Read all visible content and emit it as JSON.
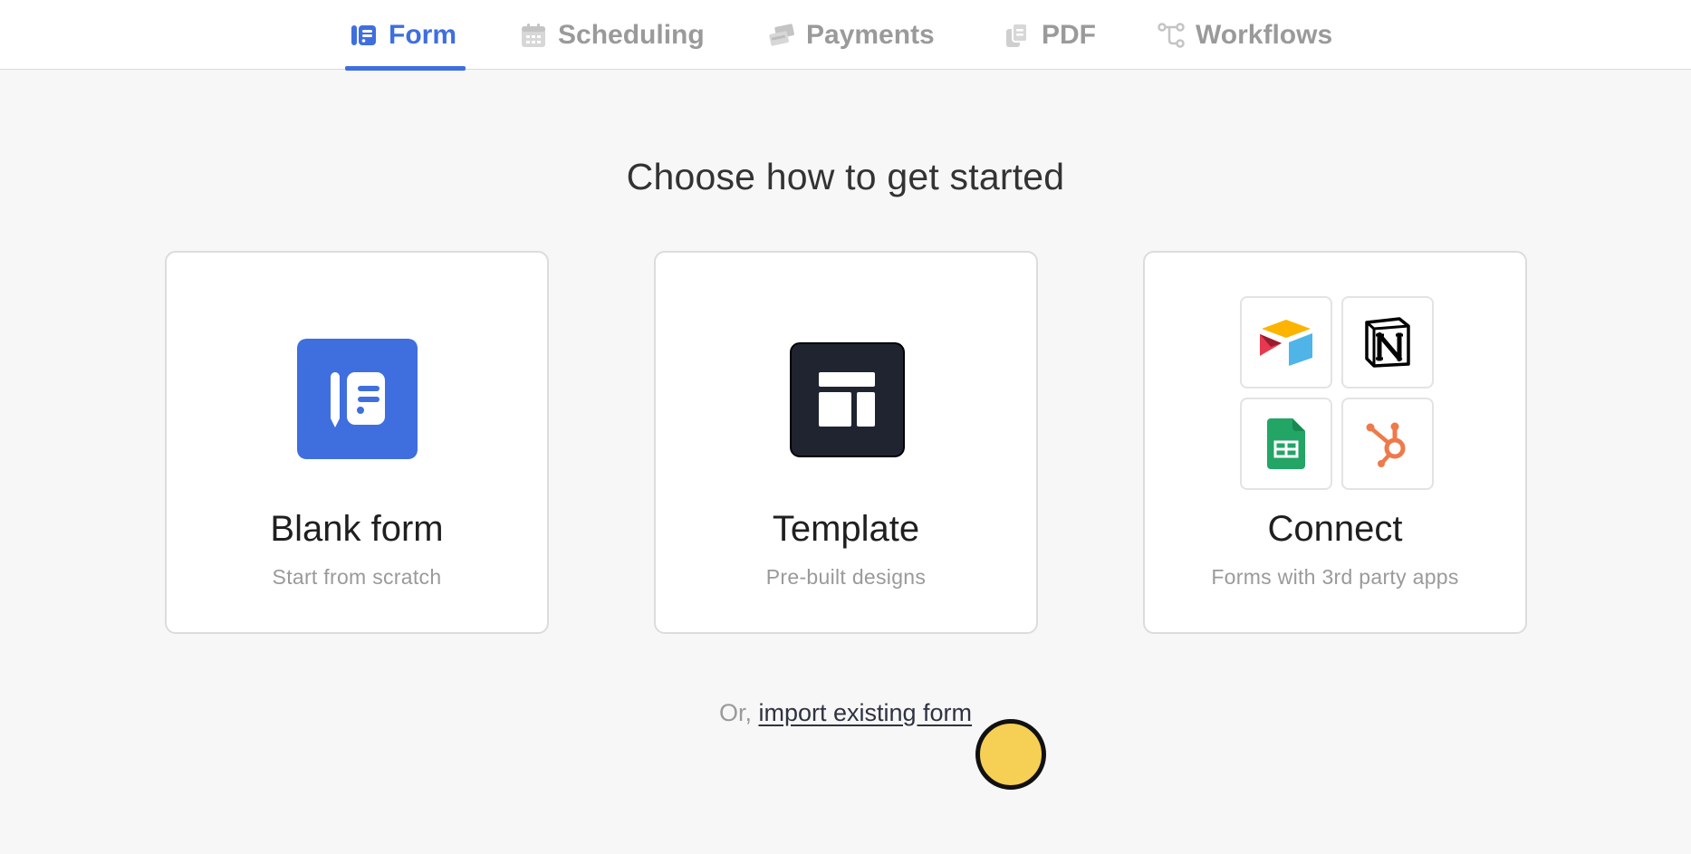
{
  "tabs": [
    {
      "label": "Form",
      "icon": "form-icon",
      "active": true
    },
    {
      "label": "Scheduling",
      "icon": "calendar-icon",
      "active": false
    },
    {
      "label": "Payments",
      "icon": "payments-icon",
      "active": false
    },
    {
      "label": "PDF",
      "icon": "pdf-icon",
      "active": false
    },
    {
      "label": "Workflows",
      "icon": "workflow-icon",
      "active": false
    }
  ],
  "heading": "Choose how to get started",
  "cards": [
    {
      "title": "Blank form",
      "subtitle": "Start from scratch",
      "icon": "blank-form-icon"
    },
    {
      "title": "Template",
      "subtitle": "Pre-built designs",
      "icon": "template-layout-icon"
    },
    {
      "title": "Connect",
      "subtitle": "Forms with 3rd party apps",
      "apps": [
        "airtable-icon",
        "notion-icon",
        "google-sheets-icon",
        "hubspot-icon"
      ]
    }
  ],
  "import": {
    "prefix": "Or,",
    "link": "import existing form"
  },
  "colors": {
    "accent": "#3f6fde",
    "tab_inactive": "#9a9a9a",
    "template_tile": "#1f2430",
    "cursor": "#f6cf55"
  }
}
